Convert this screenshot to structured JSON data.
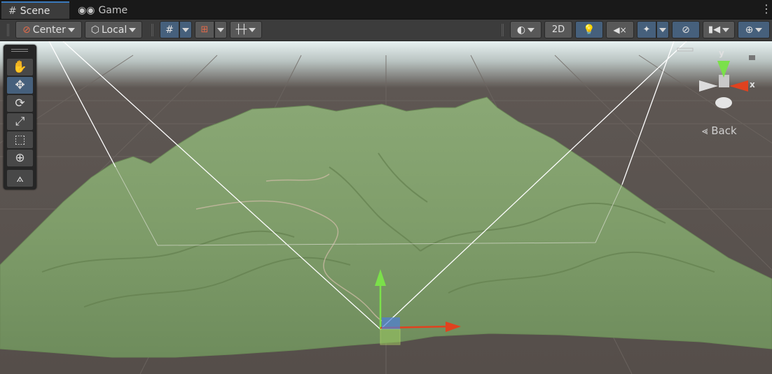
{
  "tabs": [
    {
      "label": "Scene",
      "icon": "grid-icon",
      "active": true
    },
    {
      "label": "Game",
      "icon": "gamepad-icon",
      "active": false
    }
  ],
  "toolbar": {
    "pivot_mode": "Center",
    "pivot_rotation": "Local",
    "mode_2d": "2D"
  },
  "tools": [
    {
      "name": "hand-tool",
      "icon": "hand-icon",
      "glyph": "✋"
    },
    {
      "name": "move-tool",
      "icon": "move-icon",
      "glyph": "✥"
    },
    {
      "name": "rotate-tool",
      "icon": "rotate-icon",
      "glyph": "⟳"
    },
    {
      "name": "scale-tool",
      "icon": "scale-icon",
      "glyph": "⤢"
    },
    {
      "name": "rect-tool",
      "icon": "rect-icon",
      "glyph": "⬚"
    },
    {
      "name": "transform-tool",
      "icon": "transform-icon",
      "glyph": "⊕"
    },
    {
      "name": "custom-tool",
      "icon": "path-icon",
      "glyph": "⟑"
    }
  ],
  "orientation_gizmo": {
    "y_label": "y",
    "x_label": "x",
    "projection_label": "Back"
  },
  "colors": {
    "terrain": "#8aa875",
    "sky": "#e9f2f2",
    "ground": "#5a534e",
    "axis_x": "#e0421f",
    "axis_y": "#7be04a",
    "accent": "#46607c"
  }
}
